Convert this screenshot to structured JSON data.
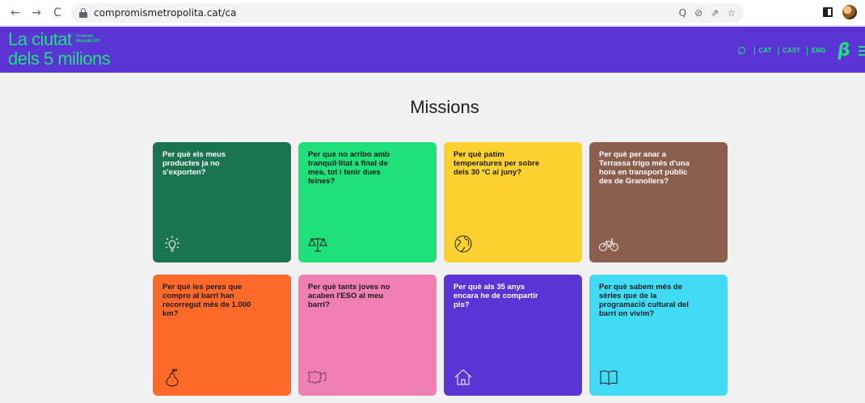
{
  "browser": {
    "url": "compromismetropolita.cat/ca",
    "back_glyph": "←",
    "forward_glyph": "→",
    "reload_glyph": "C",
    "omni_icons": [
      "Q",
      "⊘",
      "⇗",
      "☆"
    ]
  },
  "header": {
    "logo_line1": "La ciutat",
    "logo_small": "Compromís Metropolità 2030",
    "logo_line2": "dels 5 milions",
    "languages": [
      "CAT",
      "CAST",
      "ENG"
    ],
    "brand_glyph": "β",
    "colors": {
      "background": "#5b34d6",
      "accent": "#20e07d"
    }
  },
  "main": {
    "title": "Missions",
    "cards": [
      {
        "text": "Per què els meus productes ja no s'exporten?",
        "bg": "#1b7450",
        "fg": "#ffffff",
        "icon": "lightbulb-icon"
      },
      {
        "text": "Per què no arribo amb tranquil·litat a final de mes, tot i tenir dues feines?",
        "bg": "#1fe07a",
        "fg": "#1a1a1a",
        "icon": "scales-icon"
      },
      {
        "text": "Per què patim temperatures per sobre dels 30 °C al juny?",
        "bg": "#fdd230",
        "fg": "#1a1a1a",
        "icon": "globe-icon"
      },
      {
        "text": "Per què per anar a Terrassa trigo més d'una hora en transport públic des de Granollers?",
        "bg": "#8b5e4e",
        "fg": "#ffffff",
        "icon": "bicycle-icon"
      },
      {
        "text": "Per què les peres que compro al barri han recorregut més de 1.000 km?",
        "bg": "#ff6a2b",
        "fg": "#1a1a1a",
        "icon": "pear-icon"
      },
      {
        "text": "Per què tants joves no acaben l'ESO al meu barri?",
        "bg": "#f07fb3",
        "fg": "#1a1a1a",
        "icon": "puzzle-icon"
      },
      {
        "text": "Per què als 35 anys encara he de compartir pis?",
        "bg": "#5b34d6",
        "fg": "#ffffff",
        "icon": "house-icon"
      },
      {
        "text": "Per què sabem més de sèries que de la programació cultural del barri on vivim?",
        "bg": "#42dbf5",
        "fg": "#1a1a1a",
        "icon": "book-icon"
      }
    ]
  }
}
